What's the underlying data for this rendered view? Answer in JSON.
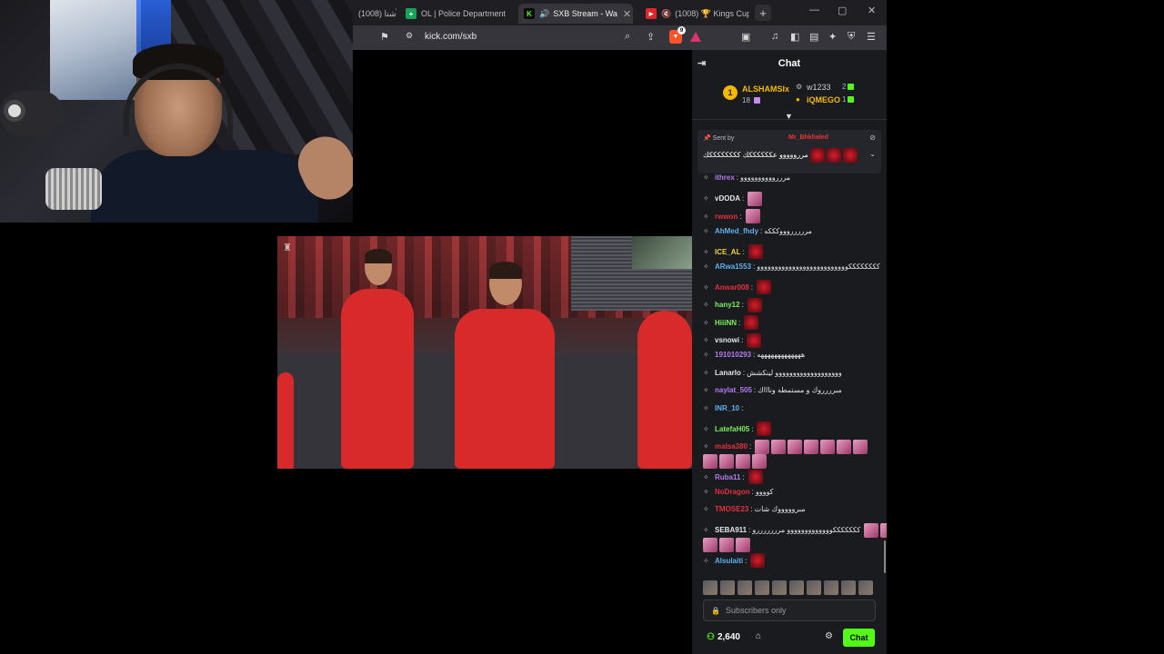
{
  "browser": {
    "tabs": [
      {
        "title": "(1008) الأشتا",
        "favicon_color": "#1f1f23",
        "active": false
      },
      {
        "title": "OL | Police Department",
        "favicon": "+",
        "favicon_color": "#19a35a",
        "active": false
      },
      {
        "title": "SXB Stream - Wa",
        "favicon": "K",
        "favicon_color": "#0b0b0b",
        "active": true
      },
      {
        "title": "(1008) 🏆 Kings Cup",
        "favicon": "▶",
        "favicon_color": "#e0262b",
        "active": false
      }
    ],
    "new_tab": "+",
    "url": "kick.com/sxb",
    "brave_badge": "9"
  },
  "video": {
    "watermark": "♜"
  },
  "chat": {
    "title": "Chat",
    "gifters": [
      {
        "rank": "1",
        "name": "ALSHAMSIx",
        "count": "18"
      },
      {
        "name": "w1233",
        "count": "2"
      },
      {
        "name": "iQMEGO",
        "count": "1"
      }
    ],
    "pinned": {
      "sent_by_label": "Sent by",
      "sender": "Mr_Bhkhaled",
      "message": "مررووووو عككككككك ككككككككك"
    },
    "messages": [
      {
        "user": "ithrex",
        "text": "مررروووووووووو",
        "color": "#b47cf0",
        "emotes": 0
      },
      {
        "user": "vDODA",
        "text": "",
        "color": "#e6e6e6",
        "emotes": 1,
        "emote_type": "pink"
      },
      {
        "user": "rwwon",
        "text": "",
        "color": "#e3303a",
        "emotes": 1,
        "emote_type": "pink"
      },
      {
        "user": "AhMed_fhdy",
        "text": "مررررروووكككه",
        "color": "#5fb0f2",
        "emotes": 0
      },
      {
        "user": "ICE_AL",
        "text": "",
        "color": "#f5d23b",
        "emotes": 1,
        "emote_type": "red"
      },
      {
        "user": "ARwa1553",
        "text": "ككككككككوووووووووووووووووووووووووو",
        "color": "#5fb0f2",
        "emotes": 0
      },
      {
        "user": "Anwar008",
        "text": "",
        "color": "#e3303a",
        "emotes": 1,
        "emote_type": "red"
      },
      {
        "user": "hany12",
        "text": "",
        "color": "#7cf05b",
        "emotes": 1,
        "emote_type": "red"
      },
      {
        "user": "HiiiNN",
        "text": "",
        "color": "#7cf05b",
        "emotes": 1,
        "emote_type": "red"
      },
      {
        "user": "vsnowi",
        "text": "",
        "color": "#e6e6e6",
        "emotes": 1,
        "emote_type": "red"
      },
      {
        "user": "191010293",
        "text": "هههههههههههههه",
        "color": "#b47cf0",
        "emotes": 0
      },
      {
        "user": "Lanarlo",
        "text": "ووووووووووووووووووو لينكشش",
        "color": "#e6e6e6",
        "emotes": 0
      },
      {
        "user": "naylat_505",
        "text": "مبرررروك و مستمطه وناااك",
        "color": "#b47cf0",
        "emotes": 0
      },
      {
        "user": "INR_10",
        "text": "",
        "color": "#5fb0f2",
        "emotes": 0
      },
      {
        "user": "LatefaH05",
        "text": "",
        "color": "#7cf05b",
        "emotes": 1,
        "emote_type": "red"
      },
      {
        "user": "malsa380",
        "text": "",
        "color": "#e3303a",
        "emotes": 11,
        "emote_type": "pink"
      },
      {
        "user": "Ruba11",
        "text": "",
        "color": "#b47cf0",
        "emotes": 1,
        "emote_type": "red"
      },
      {
        "user": "NoDragon",
        "text": "كوووو",
        "color": "#e3303a",
        "emotes": 0
      },
      {
        "user": "TMOSE23",
        "text": "مبروووووك شات",
        "color": "#e3303a",
        "emotes": 0
      },
      {
        "user": "SEBA911",
        "text": "كككككككووووووووووووو مرررررررو",
        "color": "#e6e6e6",
        "emotes": 10,
        "emote_type": "pink"
      },
      {
        "user": "Alsulaiti",
        "text": "",
        "color": "#5fb0f2",
        "emotes": 1,
        "emote_type": "red"
      }
    ],
    "input_placeholder": "Subscribers only",
    "viewers": "2,640",
    "send_label": "Chat"
  }
}
